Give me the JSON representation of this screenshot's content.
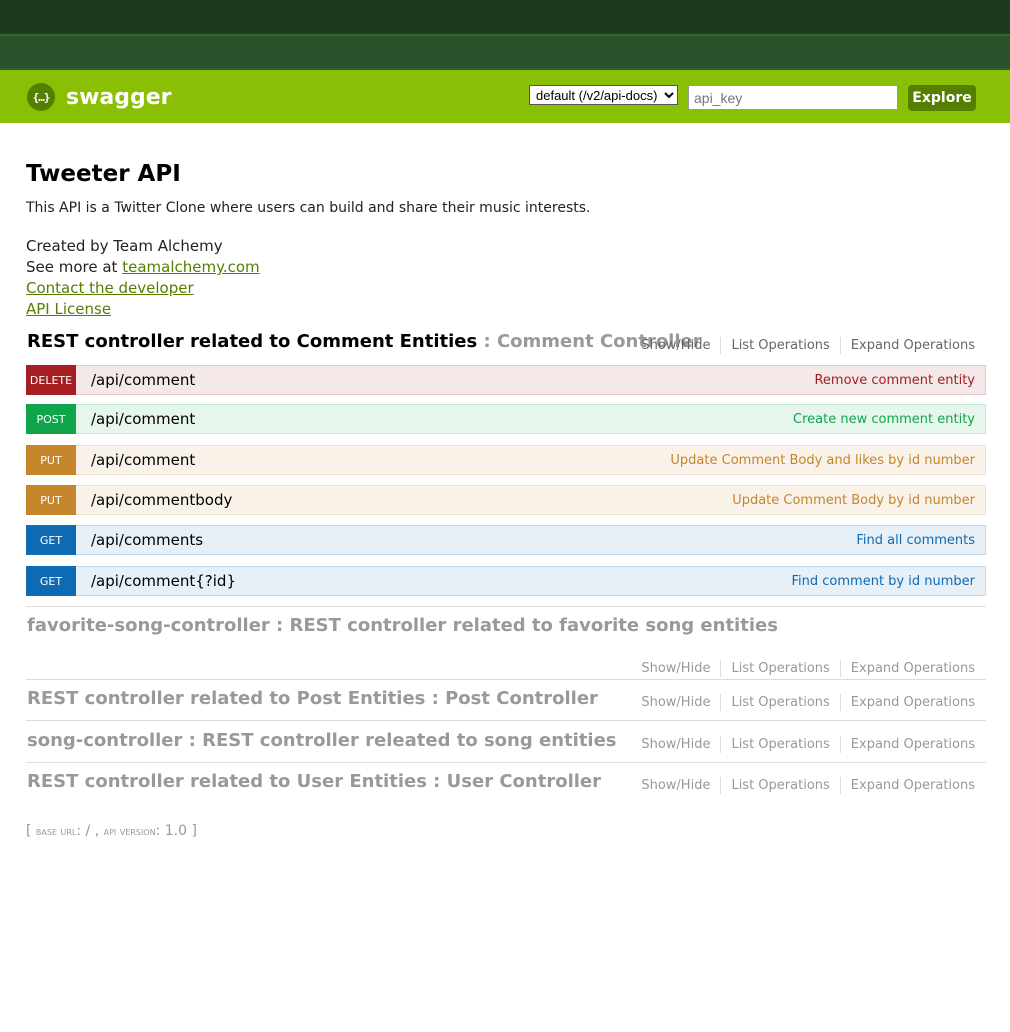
{
  "header": {
    "brand": "swagger",
    "logo_glyph": "{…}",
    "spec_select_value": "default (/v2/api-docs)",
    "api_key_placeholder": "api_key",
    "explore_label": "Explore"
  },
  "info": {
    "title": "Tweeter API",
    "description": "This API is a Twitter Clone where users can build and share their music interests.",
    "created_by": "Created by Team Alchemy",
    "see_more_prefix": "See more at ",
    "see_more_link": "teamalchemy.com",
    "contact_link": "Contact the developer",
    "license_link": "API License"
  },
  "ops_labels": {
    "show_hide": "Show/Hide",
    "list_ops": "List Operations",
    "expand_ops": "Expand Operations"
  },
  "resources": [
    {
      "name": "REST controller related to Comment Entities",
      "subtitle": " : Comment Controller",
      "operations": [
        {
          "method": "DELETE",
          "path": "/api/comment",
          "summary": "Remove comment entity"
        },
        {
          "method": "POST",
          "path": "/api/comment",
          "summary": "Create new comment entity"
        },
        {
          "method": "PUT",
          "path": "/api/comment",
          "summary": "Update Comment Body and likes by id number"
        },
        {
          "method": "PUT",
          "path": "/api/commentbody",
          "summary": "Update Comment Body by id number"
        },
        {
          "method": "GET",
          "path": "/api/comments",
          "summary": "Find all comments"
        },
        {
          "method": "GET",
          "path": "/api/comment{?id}",
          "summary": "Find comment by id number"
        }
      ]
    },
    {
      "name": "favorite-song-controller : REST controller related to favorite song entities"
    },
    {
      "name": "REST controller related to Post Entities : Post Controller"
    },
    {
      "name": "song-controller : REST controller releated to song entities"
    },
    {
      "name": "REST controller related to User Entities : User Controller"
    }
  ],
  "footer": {
    "open": "[ ",
    "base_url_label": "base url",
    "base_url_value": ": / , ",
    "api_version_label": "api version",
    "api_version_value": ": 1.0 ]"
  },
  "colors": {
    "header_green": "#89bf04",
    "delete": "#a41e22",
    "post": "#10a54a",
    "put": "#c5862b",
    "get": "#0f6ab4"
  }
}
